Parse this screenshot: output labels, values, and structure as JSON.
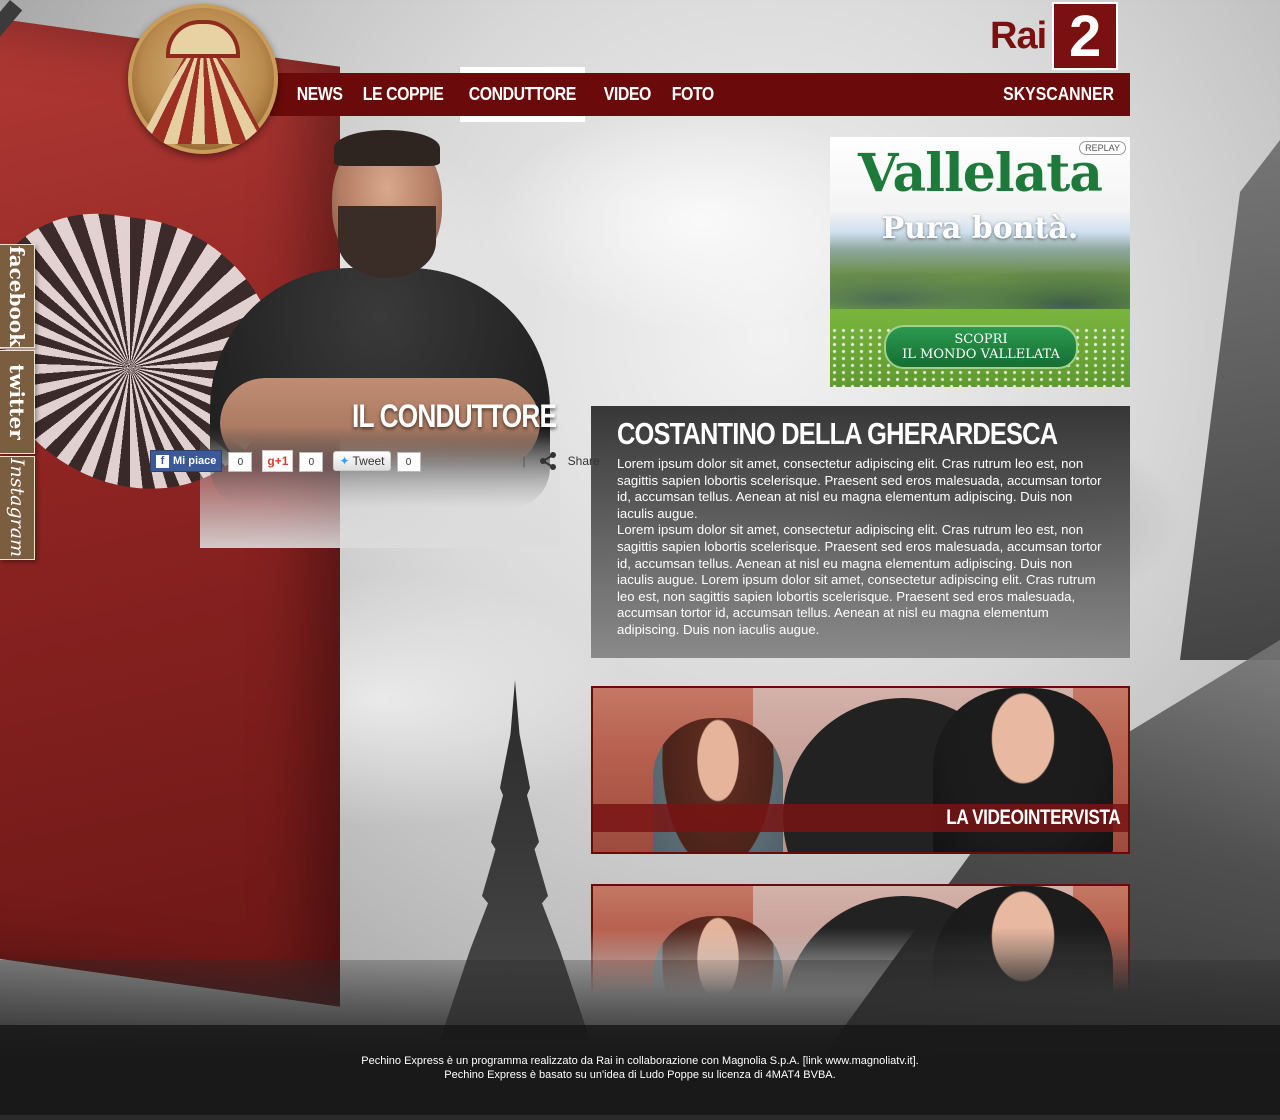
{
  "brand": {
    "rai_text": "Rai",
    "rai_number": "2"
  },
  "nav": {
    "items": [
      {
        "label": "NEWS",
        "active": false
      },
      {
        "label": "LE COPPIE",
        "active": false
      },
      {
        "label": "CONDUTTORE",
        "active": true
      },
      {
        "label": "VIDEO",
        "active": false
      },
      {
        "label": "FOTO",
        "active": false
      }
    ],
    "right_label": "SKYSCANNER"
  },
  "social_tabs": {
    "facebook": "facebook",
    "twitter": "twitter",
    "instagram": "Instagram"
  },
  "host": {
    "section_title": "IL CONDUTTORE"
  },
  "share": {
    "fb_label": "Mi piace",
    "fb_count": "0",
    "gplus_label": "+1",
    "gplus_count": "0",
    "tweet_label": "Tweet",
    "tweet_count": "0",
    "separator": "|",
    "share_label": "Share"
  },
  "ad": {
    "brand": "Vallelata",
    "tagline": "Pura bontà.",
    "replay": "REPLAY",
    "cta_line1": "SCOPRI",
    "cta_line2": "IL MONDO VALLELATA"
  },
  "bio": {
    "name": "COSTANTINO DELLA GHERARDESCA",
    "paragraph1": "Lorem ipsum dolor sit amet, consectetur adipiscing elit. Cras rutrum leo est, non sagittis sapien lobortis scelerisque. Praesent sed eros malesuada, accumsan tortor id, accumsan tellus. Aenean at nisl eu magna elementum adipiscing. Duis non iaculis augue.",
    "paragraph2": "Lorem ipsum dolor sit amet, consectetur adipiscing elit. Cras rutrum leo est, non sagittis sapien lobortis scelerisque. Praesent sed eros malesuada, accumsan tortor id, accumsan tellus. Aenean at nisl eu magna elementum adipiscing. Duis non iaculis augue. Lorem ipsum dolor sit amet, consectetur adipiscing elit. Cras rutrum leo est, non sagittis sapien lobortis scelerisque. Praesent sed eros malesuada, accumsan tortor id, accumsan tellus. Aenean at nisl eu magna elementum adipiscing. Duis non iaculis augue."
  },
  "videos": [
    {
      "label": "LA VIDEOINTERVISTA"
    }
  ],
  "footer": {
    "line1": "Pechino Express è un programma realizzato da Rai in collaborazione con Magnolia S.p.A. [link www.magnoliatv.it].",
    "line2": "Pechino Express è basato su un'idea di Ludo Poppe su licenza di 4MAT4 BVBA."
  },
  "colors": {
    "nav_bg": "#6b0a0a",
    "rai_red": "#7a1010",
    "social_tab": "#7b5e40",
    "ad_green": "#1e7a3a"
  }
}
